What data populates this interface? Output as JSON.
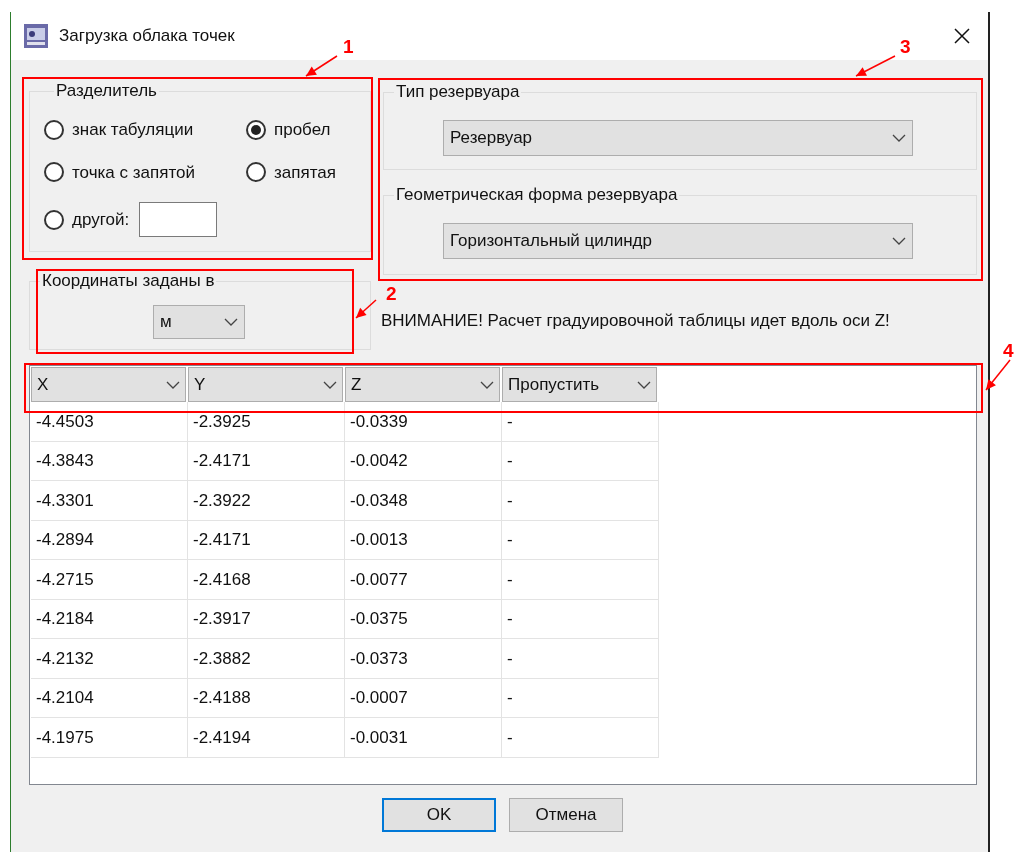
{
  "window": {
    "title": "Загрузка облака точек"
  },
  "separator_group": {
    "title": "Разделитель",
    "options": [
      {
        "label": "знак табуляции",
        "selected": false
      },
      {
        "label": "пробел",
        "selected": true
      },
      {
        "label": "точка с запятой",
        "selected": false
      },
      {
        "label": "запятая",
        "selected": false
      },
      {
        "label": "другой:",
        "selected": false
      }
    ]
  },
  "units_group": {
    "title": "Координаты заданы в",
    "value": "м"
  },
  "tank_type_group": {
    "title": "Тип резервуара",
    "value": "Резервуар"
  },
  "tank_shape_group": {
    "title": "Геометрическая форма резервуара",
    "value": "Горизонтальный цилиндр"
  },
  "warning": "ВНИМАНИЕ! Расчет градуировочной таблицы идет вдоль оси Z!",
  "table": {
    "columns": [
      "X",
      "Y",
      "Z",
      "Пропустить"
    ],
    "rows": [
      [
        "-4.4503",
        "-2.3925",
        "-0.0339",
        "-"
      ],
      [
        "-4.3843",
        "-2.4171",
        "-0.0042",
        "-"
      ],
      [
        "-4.3301",
        "-2.3922",
        "-0.0348",
        "-"
      ],
      [
        "-4.2894",
        "-2.4171",
        "-0.0013",
        "-"
      ],
      [
        "-4.2715",
        "-2.4168",
        "-0.0077",
        "-"
      ],
      [
        "-4.2184",
        "-2.3917",
        "-0.0375",
        "-"
      ],
      [
        "-4.2132",
        "-2.3882",
        "-0.0373",
        "-"
      ],
      [
        "-4.2104",
        "-2.4188",
        "-0.0007",
        "-"
      ],
      [
        "-4.1975",
        "-2.4194",
        "-0.0031",
        "-"
      ]
    ]
  },
  "buttons": [
    {
      "label": "OK",
      "default": true
    },
    {
      "label": "Отмена",
      "default": false
    }
  ],
  "annotations": [
    {
      "label": "1"
    },
    {
      "label": "2"
    },
    {
      "label": "3"
    },
    {
      "label": "4"
    }
  ]
}
